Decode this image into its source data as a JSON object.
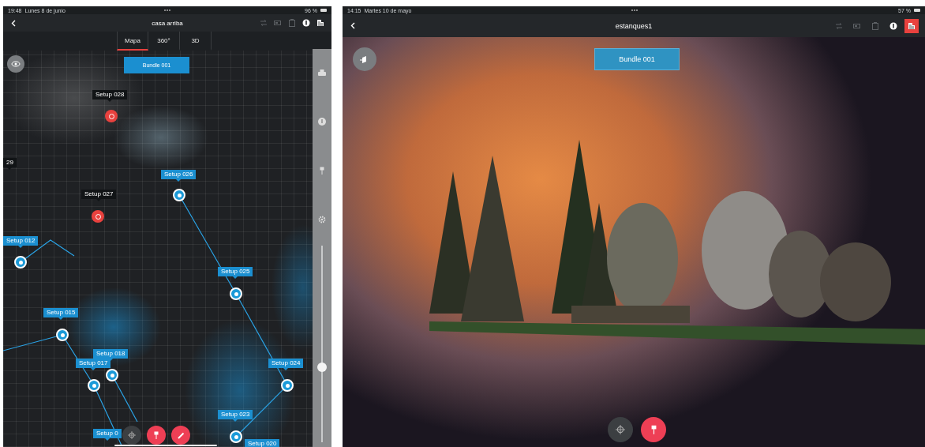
{
  "map_screen": {
    "status_bar": {
      "time": "19:48",
      "date": "Lunes 8 de junio",
      "battery": "96 %"
    },
    "title": "casa arriba",
    "toolbar": [
      {
        "disabled": true,
        "selected": false
      },
      {
        "disabled": true,
        "selected": false
      },
      {
        "disabled": true,
        "selected": false
      },
      {
        "disabled": false,
        "selected": false
      },
      {
        "disabled": false,
        "selected": false
      }
    ],
    "tabs": [
      {
        "label": "Mapa",
        "selected": true
      },
      {
        "label": "360°",
        "selected": false
      },
      {
        "label": "3D",
        "selected": false
      }
    ],
    "bundle": "Bundle 001",
    "setups": [
      {
        "label": "Setup 028",
        "kind": "unlinked",
        "color": "#e8413e"
      },
      {
        "label": "29",
        "kind": "unlinked"
      },
      {
        "label": "Setup 026",
        "kind": "linked",
        "color": "#1b9ad8"
      },
      {
        "label": "Setup 027",
        "kind": "unlinked",
        "color": "#e8413e"
      },
      {
        "label": "Setup 012",
        "kind": "linked",
        "color": "#1b9ad8"
      },
      {
        "label": "Setup 025",
        "kind": "linked",
        "color": "#1b9ad8"
      },
      {
        "label": "Setup 015",
        "kind": "linked",
        "color": "#1b9ad8"
      },
      {
        "label": "Setup 018",
        "kind": "linked",
        "color": "#1b9ad8"
      },
      {
        "label": "Setup 017",
        "kind": "linked",
        "color": "#1b9ad8"
      },
      {
        "label": "Setup 024",
        "kind": "linked",
        "color": "#1b9ad8"
      },
      {
        "label": "Setup 023",
        "kind": "linked",
        "color": "#1b9ad8"
      },
      {
        "label": "Setup 0",
        "kind": "linked"
      },
      {
        "label": "Setup 020",
        "kind": "linked"
      }
    ],
    "zoom_slider": {
      "level": 0.38
    }
  },
  "scan_screen": {
    "status_bar": {
      "time": "14:15",
      "date": "Martes 10 de mayo",
      "battery": "57 %"
    },
    "title": "estanques1",
    "toolbar": [
      {
        "disabled": true,
        "selected": false
      },
      {
        "disabled": true,
        "selected": false
      },
      {
        "disabled": true,
        "selected": false
      },
      {
        "disabled": false,
        "selected": false
      },
      {
        "disabled": false,
        "selected": true
      }
    ],
    "bundle": "Bundle 001"
  }
}
